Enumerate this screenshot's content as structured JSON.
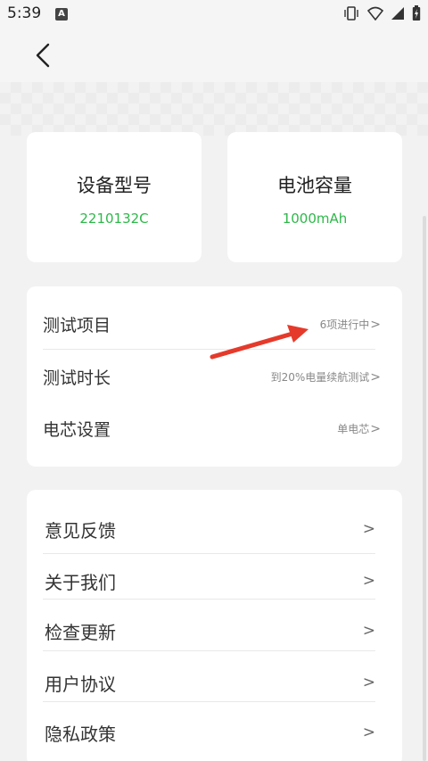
{
  "status_bar": {
    "time": "5:39",
    "notification_badge": "A"
  },
  "cards": {
    "device_model": {
      "title": "设备型号",
      "value": "2210132C"
    },
    "battery_capacity": {
      "title": "电池容量",
      "value": "1000mAh"
    }
  },
  "test_settings": [
    {
      "label": "测试项目",
      "value": "6项进行中"
    },
    {
      "label": "测试时长",
      "value": "到20%电量续航测试"
    },
    {
      "label": "电芯设置",
      "value": "单电芯"
    }
  ],
  "chevron": ">",
  "menu": [
    {
      "label": "意见反馈"
    },
    {
      "label": "关于我们"
    },
    {
      "label": "检查更新"
    },
    {
      "label": "用户协议"
    },
    {
      "label": "隐私政策"
    }
  ],
  "colors": {
    "accent_green": "#2eb84a",
    "annotation_red": "#e53a2b",
    "background": "#f2f2f2"
  }
}
